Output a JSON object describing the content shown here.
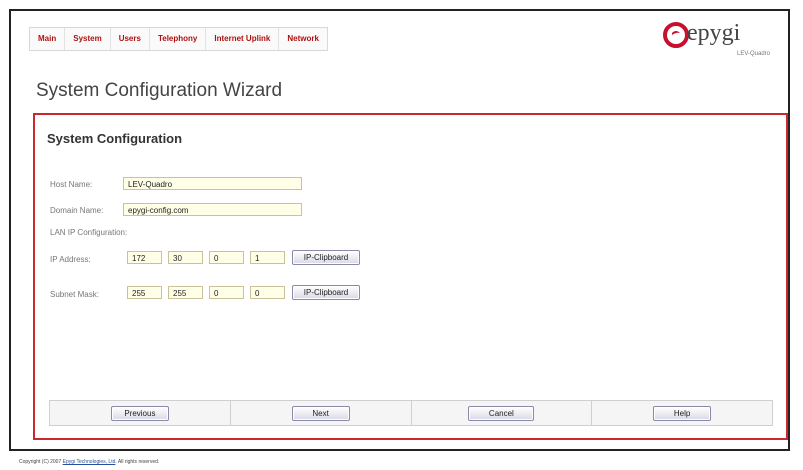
{
  "nav": {
    "items": [
      {
        "label": "Main"
      },
      {
        "label": "System"
      },
      {
        "label": "Users"
      },
      {
        "label": "Telephony"
      },
      {
        "label": "Internet Uplink"
      },
      {
        "label": "Network"
      }
    ]
  },
  "logo": {
    "name": "epygi",
    "sub": "LEV-Quadro",
    "color": "#c8102e"
  },
  "page": {
    "title": "System Configuration Wizard"
  },
  "panel": {
    "title": "System Configuration",
    "host_name": {
      "label": "Host Name:",
      "value": "LEV-Quadro"
    },
    "domain_name": {
      "label": "Domain Name:",
      "value": "epygi-config.com"
    },
    "lan_label": "LAN IP Configuration:",
    "ip_address": {
      "label": "IP Address:",
      "octets": [
        "172",
        "30",
        "0",
        "1"
      ],
      "button": "IP-Clipboard"
    },
    "subnet_mask": {
      "label": "Subnet Mask:",
      "octets": [
        "255",
        "255",
        "0",
        "0"
      ],
      "button": "IP-Clipboard"
    }
  },
  "footer": {
    "previous": "Previous",
    "next": "Next",
    "cancel": "Cancel",
    "help": "Help"
  },
  "copyright": {
    "text": "Copyright (C) 2007 ",
    "link": "Epygi Technologies, Ltd",
    "suffix": ". All rights reserved."
  }
}
